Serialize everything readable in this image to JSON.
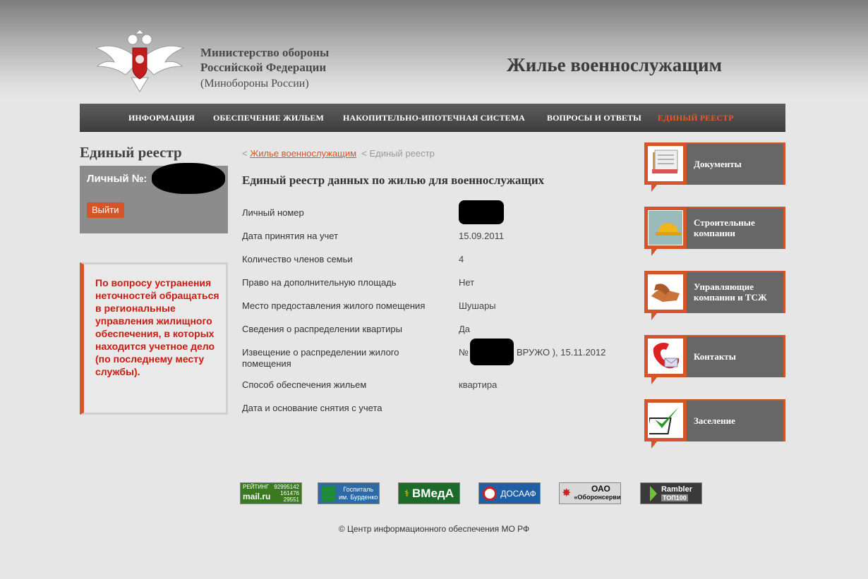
{
  "header": {
    "ministry_line1": "Министерство обороны",
    "ministry_line2": "Российской Федерации",
    "ministry_line3": "(Минобороны России)",
    "site_title": "Жилье военнослужащим"
  },
  "nav": [
    {
      "label": "ИНФОРМАЦИЯ",
      "active": false
    },
    {
      "label": "ОБЕСПЕЧЕНИЕ ЖИЛЬЕМ",
      "active": false
    },
    {
      "label": "НАКОПИТЕЛЬНО-ИПОТЕЧНАЯ СИСТЕМА",
      "active": false
    },
    {
      "label": "ВОПРОСЫ И ОТВЕТЫ",
      "active": false
    },
    {
      "label": "ЕДИНЫЙ РЕЕСТР",
      "active": true
    }
  ],
  "left": {
    "title": "Единый реестр",
    "user_label": "Личный №:",
    "logout": "Выйти",
    "notice": "По вопросу устранения неточностей обращаться в региональные управления жилищного обеспечения, в которых находится учетное дело (по последнему месту службы)."
  },
  "breadcrumb": {
    "sep": "<",
    "link": "Жилье военнослужащим",
    "current": "Единый реестр"
  },
  "main": {
    "title": "Единый реестр данных по жилью для военнослужащих",
    "rows": [
      {
        "label": "Личный номер",
        "value": ""
      },
      {
        "label": "Дата принятия на учет",
        "value": "15.09.2011"
      },
      {
        "label": "Количество членов семьи",
        "value": "4"
      },
      {
        "label": "Право на дополнительную площадь",
        "value": "Нет"
      },
      {
        "label": "Место предоставления жилого помещения",
        "value": "Шушары"
      },
      {
        "label": "Сведения о распределении квартиры",
        "value": "Да"
      },
      {
        "label": "Извещение о распределении жилого помещения",
        "value_prefix": "№",
        "value": "ВРУЖО ), 15.11.2012"
      },
      {
        "label": "Способ обеспечения жильем",
        "value": "квартира"
      },
      {
        "label": "Дата и основание снятия с учета",
        "value": ""
      }
    ]
  },
  "sidebar": [
    {
      "label": "Документы",
      "icon": "documents-icon"
    },
    {
      "label": "Строительные компании",
      "icon": "helmet-icon"
    },
    {
      "label": "Управляющие компании и ТСЖ",
      "icon": "handshake-icon"
    },
    {
      "label": "Контакты",
      "icon": "phone-icon"
    },
    {
      "label": "Заселение",
      "icon": "checkmark-icon"
    }
  ],
  "banners": {
    "mail": {
      "top": "РЕЙТИНГ",
      "count1": "92995142",
      "brand": "mail.ru",
      "count2": "161476",
      "count3": "29551"
    },
    "burdenko": {
      "line1": "Госпиталь",
      "line2": "им. Бурденко"
    },
    "vmeda": "ВМедА",
    "dosaaf": "ДОСААФ",
    "oboron": {
      "line1": "ОАО",
      "line2": "«Оборонсервис»"
    },
    "rambler": {
      "line1": "Rambler",
      "line2": "ТОП100"
    }
  },
  "footer": {
    "copyright": "© Центр информационного обеспечения МО РФ"
  },
  "colors": {
    "accent": "#d4552a",
    "nav_active": "#e35a2d",
    "notice_text": "#cc1a12"
  }
}
